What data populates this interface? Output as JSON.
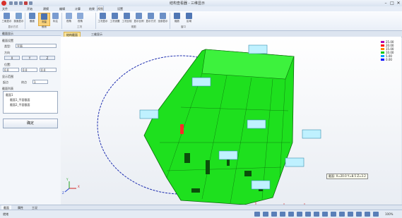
{
  "window": {
    "title": "结构查看器 - 三维显示",
    "min": "–",
    "max": "□",
    "close": "✕"
  },
  "menu": {
    "tabs": [
      "文件",
      "开始",
      "建模",
      "编辑",
      "计算",
      "结果",
      "视图",
      "设置"
    ],
    "active_index": 6
  },
  "ribbon": {
    "buttons": [
      "三维显示",
      "剖面显示",
      "截面",
      "测量",
      "标注",
      "视角",
      "视角",
      "工况显示",
      "工况设置",
      "工况比较",
      "显示比例",
      "显示方式",
      "全部显示",
      "缩放",
      "区域"
    ],
    "selected_index": 2,
    "groups": [
      "显示方式",
      "截面",
      "工况",
      "视图",
      "窗口"
    ]
  },
  "left_panel": {
    "title": "截面显示",
    "section_label": "截面设置",
    "type_label": "类型:",
    "type_value": "平面",
    "axis_label": "方向",
    "axis_buttons": [
      "X",
      "Y",
      "Z"
    ],
    "position_label": "位置:",
    "position_values": [
      "0.0",
      "0.0",
      "0.0"
    ],
    "range_label": "显示范围",
    "range_from_label": "起点",
    "range_to_label": "终点",
    "range_value": "1",
    "tree_header": "截面列表",
    "tree_items": [
      "截面1",
      "截面1_平面截面",
      "截面2_平面截面"
    ],
    "ok_label": "确定"
  },
  "doc_tabs": [
    "结构截面",
    "三维显示"
  ],
  "viewport": {
    "legend": [
      {
        "value": "25.00",
        "color": "#b000b0"
      },
      {
        "value": "20.00",
        "color": "#ff0000"
      },
      {
        "value": "15.00",
        "color": "#ff8800"
      },
      {
        "value": "10.00",
        "color": "#00c800"
      },
      {
        "value": "5.00",
        "color": "#00a0ff"
      },
      {
        "value": "0.00",
        "color": "#0000ff"
      }
    ],
    "tooltip": "截面: X=20.0 Y=8.5 Z=3.2",
    "axis_labels": [
      "X",
      "Y",
      "Z"
    ],
    "mesh_color": "#1ee01e"
  },
  "bottom_tabs": [
    "截面",
    "属性",
    "工况"
  ],
  "status": {
    "text": "就绪",
    "zoom": "100%"
  }
}
